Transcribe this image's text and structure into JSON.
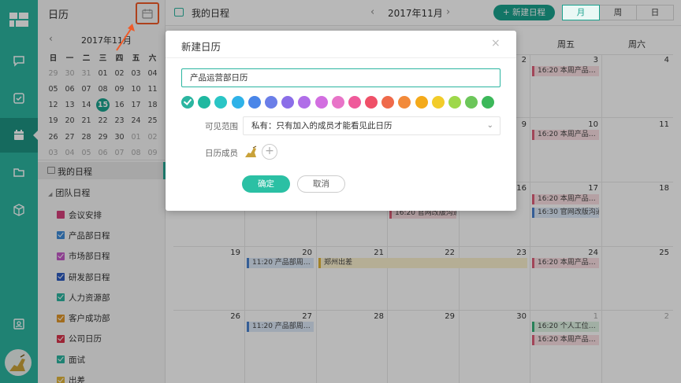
{
  "rail": {
    "icons": [
      "logo-icon",
      "chat-icon",
      "task-icon",
      "calendar-icon",
      "folder-icon",
      "box-icon",
      "contacts-icon"
    ]
  },
  "sidebar": {
    "title": "日历",
    "mini_calendar": {
      "month_label": "2017年11月",
      "weekday_headers": [
        "日",
        "一",
        "二",
        "三",
        "四",
        "五",
        "六"
      ],
      "weeks": [
        [
          "29",
          "30",
          "31",
          "01",
          "02",
          "03",
          "04"
        ],
        [
          "05",
          "06",
          "07",
          "08",
          "09",
          "10",
          "11"
        ],
        [
          "12",
          "13",
          "14",
          "15",
          "16",
          "17",
          "18"
        ],
        [
          "19",
          "20",
          "21",
          "22",
          "23",
          "24",
          "25"
        ],
        [
          "26",
          "27",
          "28",
          "29",
          "30",
          "01",
          "02"
        ],
        [
          "03",
          "04",
          "05",
          "06",
          "07",
          "08",
          "09"
        ]
      ],
      "today": "15"
    },
    "my_schedule_label": "我的日程",
    "team_label": "团队日程",
    "calendars": [
      {
        "label": "会议安排",
        "color": "#d6407c",
        "checked": false
      },
      {
        "label": "产品部日程",
        "color": "#3d8bd8",
        "checked": true
      },
      {
        "label": "市场部日程",
        "color": "#c45ac8",
        "checked": true
      },
      {
        "label": "研发部日程",
        "color": "#2d5bbf",
        "checked": true
      },
      {
        "label": "人力资源部",
        "color": "#2bb5a0",
        "checked": true
      },
      {
        "label": "客户成功部",
        "color": "#e0962a",
        "checked": true
      },
      {
        "label": "公司日历",
        "color": "#d8344c",
        "checked": true
      },
      {
        "label": "面试",
        "color": "#2bb5a0",
        "checked": true
      },
      {
        "label": "出差",
        "color": "#e1b43a",
        "checked": true
      }
    ]
  },
  "topbar": {
    "title": "我的日程",
    "prev": "‹",
    "month": "2017年11月",
    "next": "›",
    "new_button": "+ 新建日程",
    "views": [
      "月",
      "周",
      "日"
    ],
    "active_view": "月"
  },
  "weekday_heads": [
    "周五",
    "周六"
  ],
  "day_numbers": {
    "w1": [
      "2",
      "3",
      "4"
    ],
    "w2": [
      "9",
      "10",
      "11"
    ],
    "w3": [
      "16",
      "17",
      "18"
    ],
    "w4": [
      "19",
      "20",
      "21",
      "22",
      "23",
      "24",
      "25"
    ],
    "w5": [
      "26",
      "27",
      "28",
      "29",
      "30",
      "1",
      "2"
    ]
  },
  "events": {
    "w1_fri": "16:20 本周产品…",
    "w2_fri": "16:20 本周产品…",
    "w3_thu": "16:20 官网改版沟通",
    "w3_fri_1": "16:20 本周产品…",
    "w3_fri_2": "16:30 官网改版沟通",
    "w4_mon": "11:20 产品部周…",
    "w4_tue": "郑州出差",
    "w4_fri": "16:20 本周产品…",
    "w5_mon": "11:20 产品部周…",
    "w5_fri_1": "16:20 个人工位…",
    "w5_fri_2": "16:20 本周产品…"
  },
  "dialog": {
    "title": "新建日历",
    "close": "×",
    "name_value": "产品运营部日历",
    "colors": [
      "#2bb5a0",
      "#1fb8a0",
      "#2ac5c5",
      "#2fb2e8",
      "#4a86e8",
      "#6a7ee8",
      "#8b6ee8",
      "#b06ee8",
      "#d26ee0",
      "#e874c8",
      "#ef5a9a",
      "#ef5068",
      "#ef6a4a",
      "#f28a3a",
      "#f4aa1a",
      "#f2cc2a",
      "#9ed84a",
      "#6cc65a",
      "#3cb85a"
    ],
    "selected_color_index": 0,
    "scope_label": "可见范围",
    "scope_value": "私有：只有加入的成员才能看见此日历",
    "members_label": "日历成员",
    "add_member": "+",
    "ok": "确定",
    "cancel": "取消"
  }
}
